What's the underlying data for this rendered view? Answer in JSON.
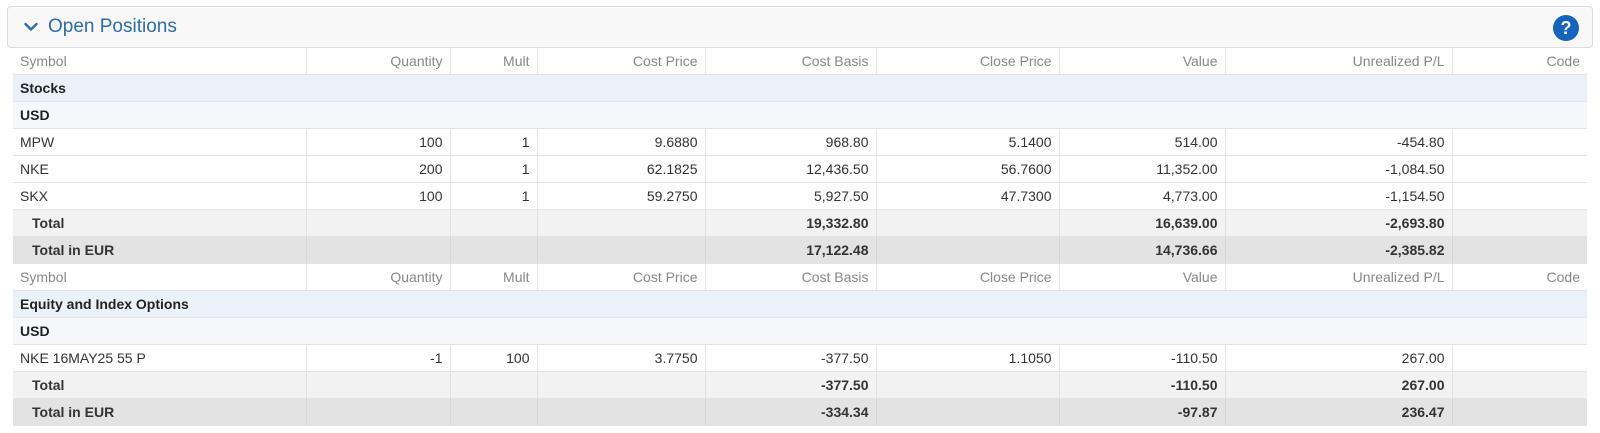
{
  "panel": {
    "title": "Open Positions",
    "help_label": "?"
  },
  "columns": [
    "Symbol",
    "Quantity",
    "Mult",
    "Cost Price",
    "Cost Basis",
    "Close Price",
    "Value",
    "Unrealized P/L",
    "Code"
  ],
  "stocks": {
    "group": "Stocks",
    "currency": "USD",
    "rows": [
      {
        "symbol": "MPW",
        "quantity": "100",
        "mult": "1",
        "cost_price": "9.6880",
        "cost_basis": "968.80",
        "close_price": "5.1400",
        "value": "514.00",
        "unrealized": "-454.80",
        "code": ""
      },
      {
        "symbol": "NKE",
        "quantity": "200",
        "mult": "1",
        "cost_price": "62.1825",
        "cost_basis": "12,436.50",
        "close_price": "56.7600",
        "value": "11,352.00",
        "unrealized": "-1,084.50",
        "code": ""
      },
      {
        "symbol": "SKX",
        "quantity": "100",
        "mult": "1",
        "cost_price": "59.2750",
        "cost_basis": "5,927.50",
        "close_price": "47.7300",
        "value": "4,773.00",
        "unrealized": "-1,154.50",
        "code": ""
      }
    ],
    "total": {
      "label": "Total",
      "cost_basis": "19,332.80",
      "value": "16,639.00",
      "unrealized": "-2,693.80"
    },
    "total_eur": {
      "label": "Total in EUR",
      "cost_basis": "17,122.48",
      "value": "14,736.66",
      "unrealized": "-2,385.82"
    }
  },
  "options": {
    "group": "Equity and Index Options",
    "currency": "USD",
    "rows": [
      {
        "symbol": "NKE 16MAY25 55 P",
        "quantity": "-1",
        "mult": "100",
        "cost_price": "3.7750",
        "cost_basis": "-377.50",
        "close_price": "1.1050",
        "value": "-110.50",
        "unrealized": "267.00",
        "code": ""
      }
    ],
    "total": {
      "label": "Total",
      "cost_basis": "-377.50",
      "value": "-110.50",
      "unrealized": "267.00"
    },
    "total_eur": {
      "label": "Total in EUR",
      "cost_basis": "-334.34",
      "value": "-97.87",
      "unrealized": "236.47"
    }
  },
  "colors": {
    "accent": "#2b6cb0",
    "help_bg": "#1565c0",
    "group_bg": "#eaf1f9"
  },
  "icons": {
    "collapse": "chevron-down-icon",
    "help": "question-icon"
  }
}
